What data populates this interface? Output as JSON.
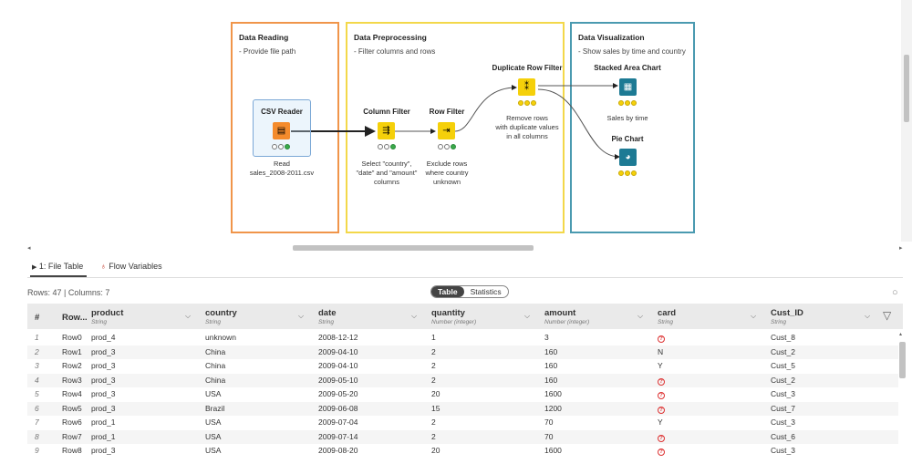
{
  "workflow": {
    "annotations": [
      {
        "title": "Data Reading",
        "desc": "- Provide file path",
        "color": "#f0954a"
      },
      {
        "title": "Data Preprocessing",
        "desc": "- Filter columns and rows",
        "color": "#f3d84a"
      },
      {
        "title": "Data Visualization",
        "desc": "- Show sales by time and country",
        "color": "#4a9ab0"
      }
    ],
    "nodes": {
      "csv_reader": {
        "title": "CSV Reader",
        "desc": "Read\nsales_2008-2011.csv",
        "color": "#f48b2c"
      },
      "column_filter": {
        "title": "Column Filter",
        "desc": "Select \"country\",\n\"date\" and \"amount\"\ncolumns",
        "color": "#f5d00a"
      },
      "row_filter": {
        "title": "Row Filter",
        "desc": "Exclude rows\nwhere country\nunknown",
        "color": "#f5d00a"
      },
      "dup_filter": {
        "title": "Duplicate Row Filter",
        "desc": "Remove rows\nwith duplicate values\nin all columns",
        "color": "#f5d00a"
      },
      "stacked": {
        "title": "Stacked Area Chart",
        "desc": "Sales by time",
        "color": "#1d7a94"
      },
      "pie": {
        "title": "Pie Chart",
        "desc": "",
        "color": "#1d7a94"
      }
    }
  },
  "tabs": {
    "file_table": "1: File Table",
    "flow_vars": "Flow Variables"
  },
  "info": "Rows: 47  |  Columns: 7",
  "toggle": {
    "table": "Table",
    "statistics": "Statistics"
  },
  "columns": [
    {
      "name": "#",
      "type": ""
    },
    {
      "name": "Row...",
      "type": ""
    },
    {
      "name": "product",
      "type": "String"
    },
    {
      "name": "country",
      "type": "String"
    },
    {
      "name": "date",
      "type": "String"
    },
    {
      "name": "quantity",
      "type": "Number (integer)"
    },
    {
      "name": "amount",
      "type": "Number (integer)"
    },
    {
      "name": "card",
      "type": "String"
    },
    {
      "name": "Cust_ID",
      "type": "String"
    }
  ],
  "rows": [
    [
      "1",
      "Row0",
      "prod_4",
      "unknown",
      "2008-12-12",
      "1",
      "3",
      "?",
      "Cust_8"
    ],
    [
      "2",
      "Row1",
      "prod_3",
      "China",
      "2009-04-10",
      "2",
      "160",
      "N",
      "Cust_2"
    ],
    [
      "3",
      "Row2",
      "prod_3",
      "China",
      "2009-04-10",
      "2",
      "160",
      "Y",
      "Cust_5"
    ],
    [
      "4",
      "Row3",
      "prod_3",
      "China",
      "2009-05-10",
      "2",
      "160",
      "?",
      "Cust_2"
    ],
    [
      "5",
      "Row4",
      "prod_3",
      "USA",
      "2009-05-20",
      "20",
      "1600",
      "?",
      "Cust_3"
    ],
    [
      "6",
      "Row5",
      "prod_3",
      "Brazil",
      "2009-06-08",
      "15",
      "1200",
      "?",
      "Cust_7"
    ],
    [
      "7",
      "Row6",
      "prod_1",
      "USA",
      "2009-07-04",
      "2",
      "70",
      "Y",
      "Cust_3"
    ],
    [
      "8",
      "Row7",
      "prod_1",
      "USA",
      "2009-07-14",
      "2",
      "70",
      "?",
      "Cust_6"
    ],
    [
      "9",
      "Row8",
      "prod_3",
      "USA",
      "2009-08-20",
      "20",
      "1600",
      "?",
      "Cust_3"
    ]
  ]
}
